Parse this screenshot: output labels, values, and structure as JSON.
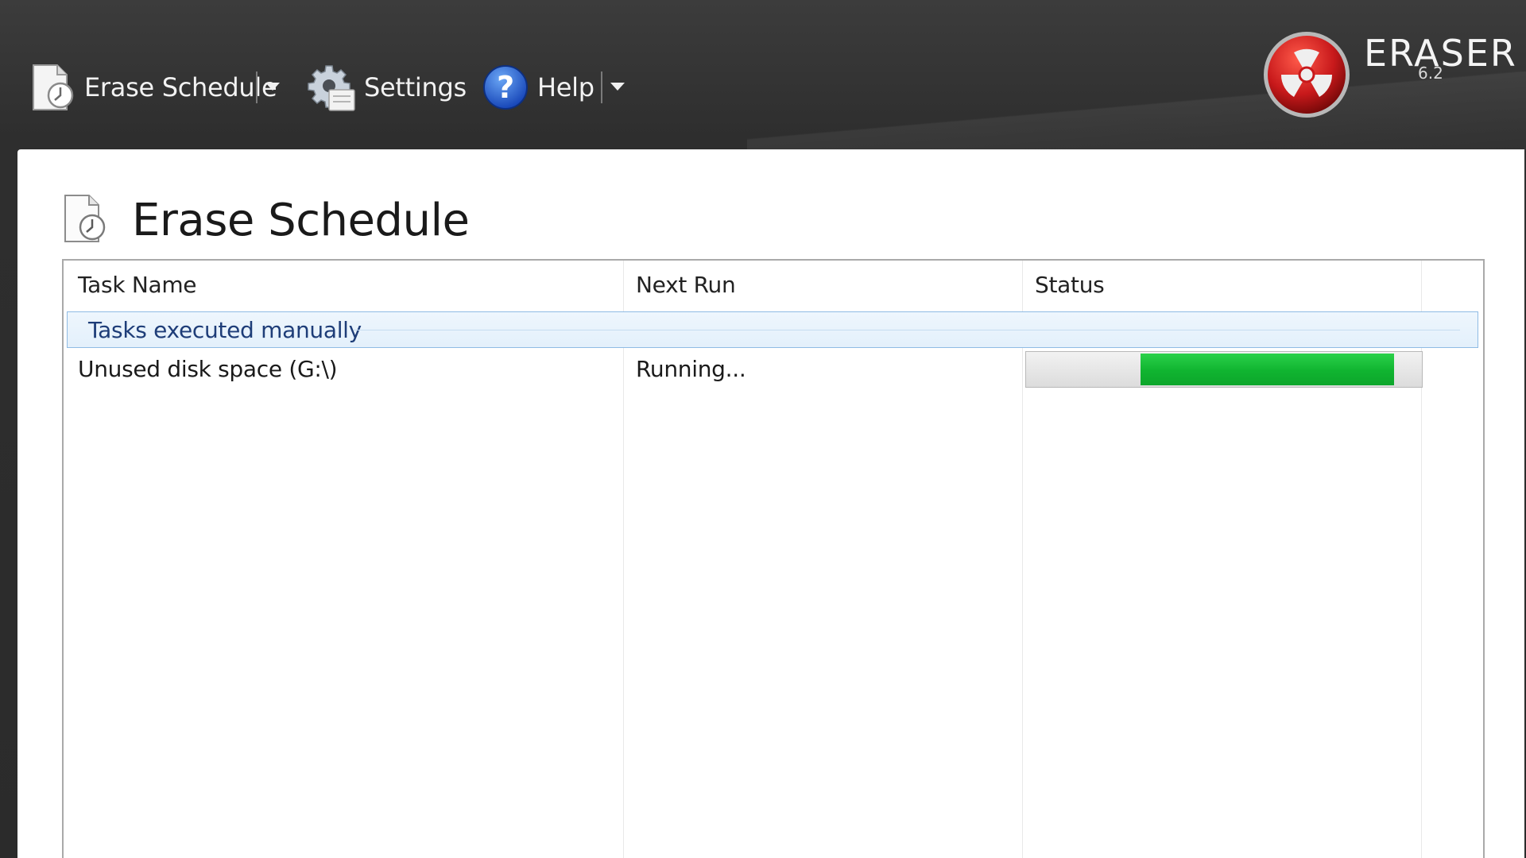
{
  "toolbar": {
    "erase_schedule_label": "Erase Schedule",
    "settings_label": "Settings",
    "help_label": "Help"
  },
  "logo": {
    "name": "ERASER",
    "version": "6.2"
  },
  "page": {
    "title": "Erase Schedule"
  },
  "table": {
    "columns": [
      "Task Name",
      "Next Run",
      "Status"
    ],
    "groups": [
      {
        "label": "Tasks executed manually",
        "tasks": [
          {
            "name": "Unused disk space (G:\\)",
            "next_run": "Running...",
            "progress_start": 0.29,
            "progress_end": 0.93
          }
        ]
      }
    ]
  },
  "colors": {
    "progress_green": "#10b430",
    "selection_border": "#8fbbe4",
    "group_text": "#1e3d78",
    "logo_red": "#c8191b"
  },
  "icons": {
    "erase_schedule": "document-clock-icon",
    "settings": "gear-icon",
    "help": "question-circle-icon",
    "dropdown": "chevron-down-icon",
    "logo": "radiation-icon"
  }
}
